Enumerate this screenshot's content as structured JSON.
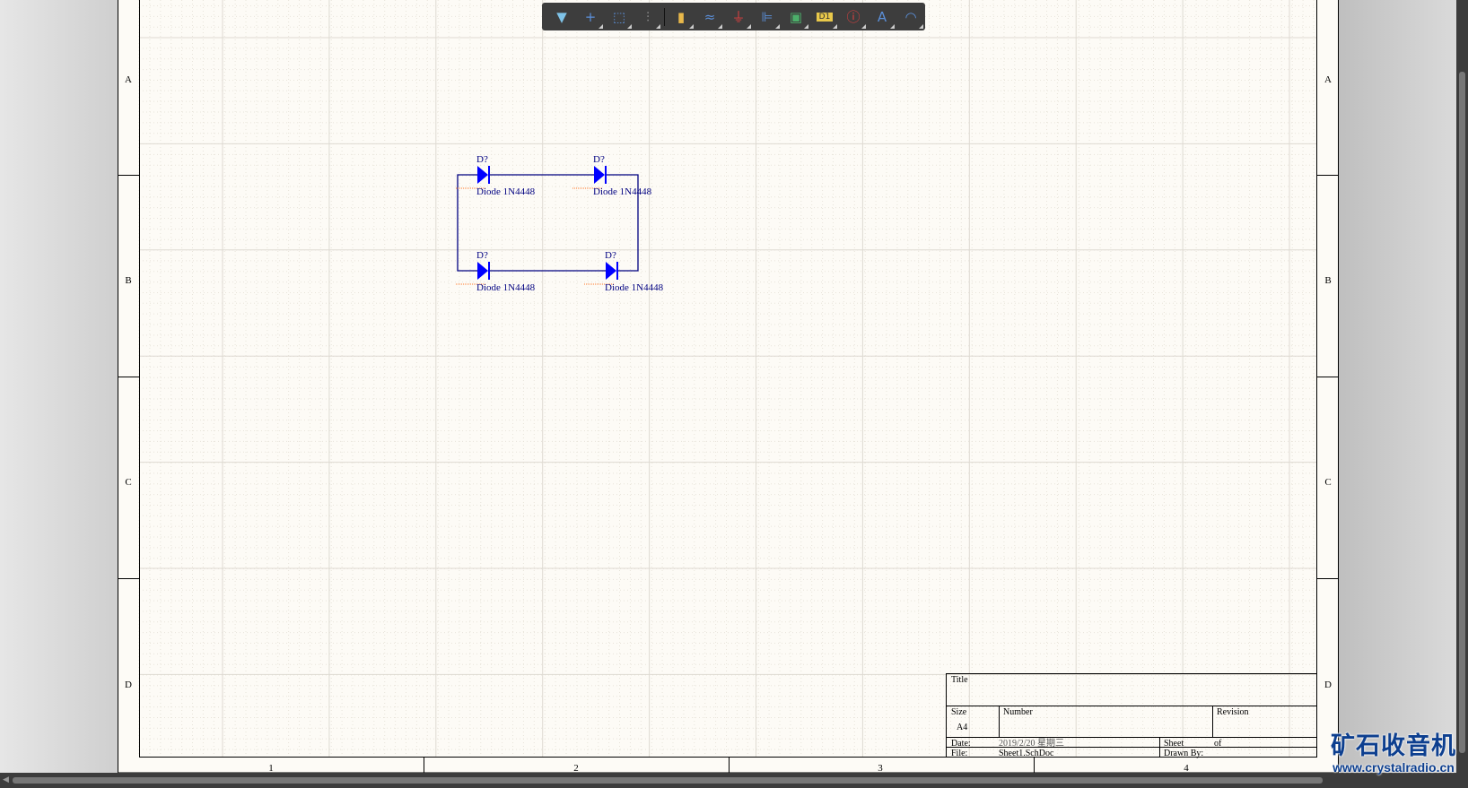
{
  "toolbar": {
    "tools": [
      {
        "icon": "filter-icon",
        "glyph": "▼",
        "color": "#7fc3e8"
      },
      {
        "icon": "crosshair-move-icon",
        "glyph": "+",
        "color": "#5b8fd8"
      },
      {
        "icon": "select-rectangle-icon",
        "glyph": "⬚",
        "color": "#5b8fd8"
      },
      {
        "icon": "align-icon",
        "glyph": "⫶",
        "color": "#888888"
      },
      {
        "icon": "component-icon",
        "glyph": "▮",
        "color": "#e8b84a"
      },
      {
        "icon": "wire-icon",
        "glyph": "≈",
        "color": "#5b8fd8"
      },
      {
        "icon": "ground-power-icon",
        "glyph": "⏚",
        "color": "#e04040"
      },
      {
        "icon": "bus-harness-icon",
        "glyph": "⊫",
        "color": "#5b8fd8"
      },
      {
        "icon": "sheet-symbol-icon",
        "glyph": "▣",
        "color": "#4caf6a"
      },
      {
        "icon": "port-icon",
        "glyph": "D1",
        "color": "#e8c84a"
      },
      {
        "icon": "no-erc-directive-icon",
        "glyph": "ⓘ",
        "color": "#e04040"
      },
      {
        "icon": "text-icon",
        "glyph": "A",
        "color": "#5b8fd8"
      },
      {
        "icon": "arc-icon",
        "glyph": "◠",
        "color": "#5b8fd8"
      }
    ]
  },
  "zones": {
    "rows": [
      "A",
      "B",
      "C",
      "D"
    ],
    "columns": [
      "1",
      "2",
      "3",
      "4"
    ]
  },
  "components": [
    {
      "designator": "D?",
      "comment": "Diode 1N4448"
    },
    {
      "designator": "D?",
      "comment": "Diode 1N4448"
    },
    {
      "designator": "D?",
      "comment": "Diode 1N4448"
    },
    {
      "designator": "D?",
      "comment": "Diode 1N4448"
    }
  ],
  "title_block": {
    "title_label": "Title",
    "size_label": "Size",
    "size_value": "A4",
    "number_label": "Number",
    "revision_label": "Revision",
    "date_label": "Date:",
    "date_value": "2019/2/20 星期三",
    "sheet_label": "Sheet",
    "of_label": "of",
    "file_label": "File:",
    "file_value": "Sheet1.SchDoc",
    "drawn_by_label": "Drawn By:"
  },
  "watermark": {
    "line1": "矿石收音机",
    "line2": "www.crystalradio.cn"
  },
  "colors": {
    "sheet": "#fdfbf6",
    "wire": "#000080",
    "diode": "#0000ff",
    "text": "#000080"
  }
}
